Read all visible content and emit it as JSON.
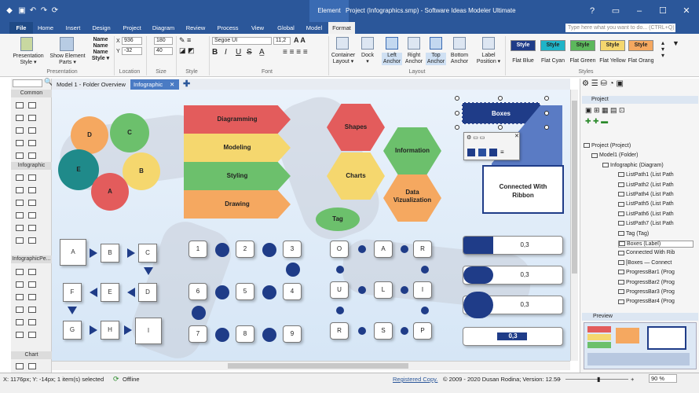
{
  "window": {
    "title": "Project (Infographics.smp) - Software Ideas Modeler Ultimate",
    "context_tab": "Element"
  },
  "menu_tabs": [
    "File",
    "Home",
    "Insert",
    "Design",
    "Project",
    "Diagram",
    "Review",
    "Process",
    "View",
    "Global",
    "Model",
    "Format"
  ],
  "help_placeholder": "Type here what you want to do... (CTRL+Q)",
  "ribbon": {
    "presentation": {
      "group": "Presentation",
      "b1": "Presentation",
      "b1b": "Style",
      "b2": "Show Element",
      "b2b": "Parts",
      "b3": "Name",
      "b3b": "Style"
    },
    "location": {
      "group": "Location",
      "x_label": "X",
      "x": "936",
      "y_label": "Y",
      "y": "-32"
    },
    "size": {
      "group": "Size",
      "w": "180",
      "h": "40"
    },
    "style": {
      "group": "Style"
    },
    "font": {
      "group": "Font",
      "family": "Segoe UI",
      "size": "11,2",
      "bold": "B",
      "italic": "I",
      "underline": "U",
      "strike": "S"
    },
    "layout": {
      "group": "Layout",
      "container": "Container",
      "container_b": "Layout",
      "dock": "Dock",
      "left": "Left",
      "left_b": "Anchor",
      "right": "Right",
      "right_b": "Anchor",
      "top": "Top",
      "top_b": "Anchor",
      "bottom": "Bottom",
      "bottom_b": "Anchor",
      "label": "Label",
      "label_b": "Position"
    },
    "styles": {
      "group": "Styles",
      "btn": "Style",
      "items": [
        {
          "name": "Flat Blue",
          "color": "#1f3c88",
          "text": "#ffffff"
        },
        {
          "name": "Flat Cyan",
          "color": "#1fb4c8",
          "text": "#222222"
        },
        {
          "name": "Flat Green",
          "color": "#5cb85c",
          "text": "#222222"
        },
        {
          "name": "Flat Yellow",
          "color": "#f5d76e",
          "text": "#222222"
        },
        {
          "name": "Flat Orang",
          "color": "#f5a860",
          "text": "#222222"
        }
      ]
    }
  },
  "toolbox": {
    "sections": [
      "Common",
      "Infographic",
      "InfographicPe...",
      "Chart"
    ]
  },
  "doc_tabs": [
    {
      "label": "Model 1 - Folder Overview"
    },
    {
      "label": "Infographic",
      "close": "✕"
    }
  ],
  "canvas": {
    "circles": [
      {
        "label": "D",
        "color": "#f5a860"
      },
      {
        "label": "C",
        "color": "#6cc06c"
      },
      {
        "label": "E",
        "color": "#1f8a8a"
      },
      {
        "label": "B",
        "color": "#f5d76e"
      },
      {
        "label": "A",
        "color": "#e35c5c"
      }
    ],
    "flags": [
      {
        "label": "Diagramming",
        "color": "#e35c5c"
      },
      {
        "label": "Modeling",
        "color": "#f5d76e"
      },
      {
        "label": "Styling",
        "color": "#6cc06c"
      },
      {
        "label": "Drawing",
        "color": "#f5a860"
      }
    ],
    "hexes": [
      {
        "label": "Shapes",
        "color": "#e35c5c"
      },
      {
        "label": "Information",
        "color": "#6cc06c"
      },
      {
        "label": "Charts",
        "color": "#f5d76e"
      },
      {
        "label": "Data",
        "label2": "Vizualization",
        "color": "#f5a860"
      }
    ],
    "tag": "Tag",
    "boxes": "Boxes",
    "callout": {
      "l1": "Connected With",
      "l2": "Ribbon"
    },
    "flow": [
      "A",
      "B",
      "C",
      "F",
      "E",
      "D",
      "G",
      "H",
      "I"
    ],
    "numbers": [
      "1",
      "2",
      "3",
      "6",
      "5",
      "4",
      "7",
      "8",
      "9"
    ],
    "letters": [
      "O",
      "A",
      "R",
      "U",
      "L",
      "I",
      "R",
      "S",
      "P"
    ],
    "progress": [
      {
        "value": "0,3",
        "fill": 0.3
      },
      {
        "value": "0,3",
        "fill": 0.3
      },
      {
        "value": "0,3",
        "fill": 0.3
      },
      {
        "value": "0,3",
        "fill": 0.3
      }
    ]
  },
  "panel": {
    "project_label": "Project",
    "tree": [
      "Project (Project)",
      "Model1 (Folder)",
      "Infographic (Diagram)",
      "ListPath1 (List Path",
      "ListPath2 (List Path",
      "ListPath4 (List Path",
      "ListPath5 (List Path",
      "ListPath6 (List Path",
      "ListPath7 (List Path",
      "Tag (Tag)",
      "Boxes (Label)",
      "Connected With Rib",
      "[Boxes — Connect",
      "ProgressBar1 (Prog",
      "ProgressBar2 (Prog",
      "ProgressBar3 (Prog",
      "ProgressBar4 (Prog"
    ],
    "preview": "Preview"
  },
  "status": {
    "coords": "X: 1176px; Y: -14px; 1 item(s) selected",
    "offline": "Offline",
    "registered": "Registered Copy.",
    "copyright": "© 2009 - 2020 Dusan Rodina; Version: 12.50",
    "zoom": "90 %"
  }
}
